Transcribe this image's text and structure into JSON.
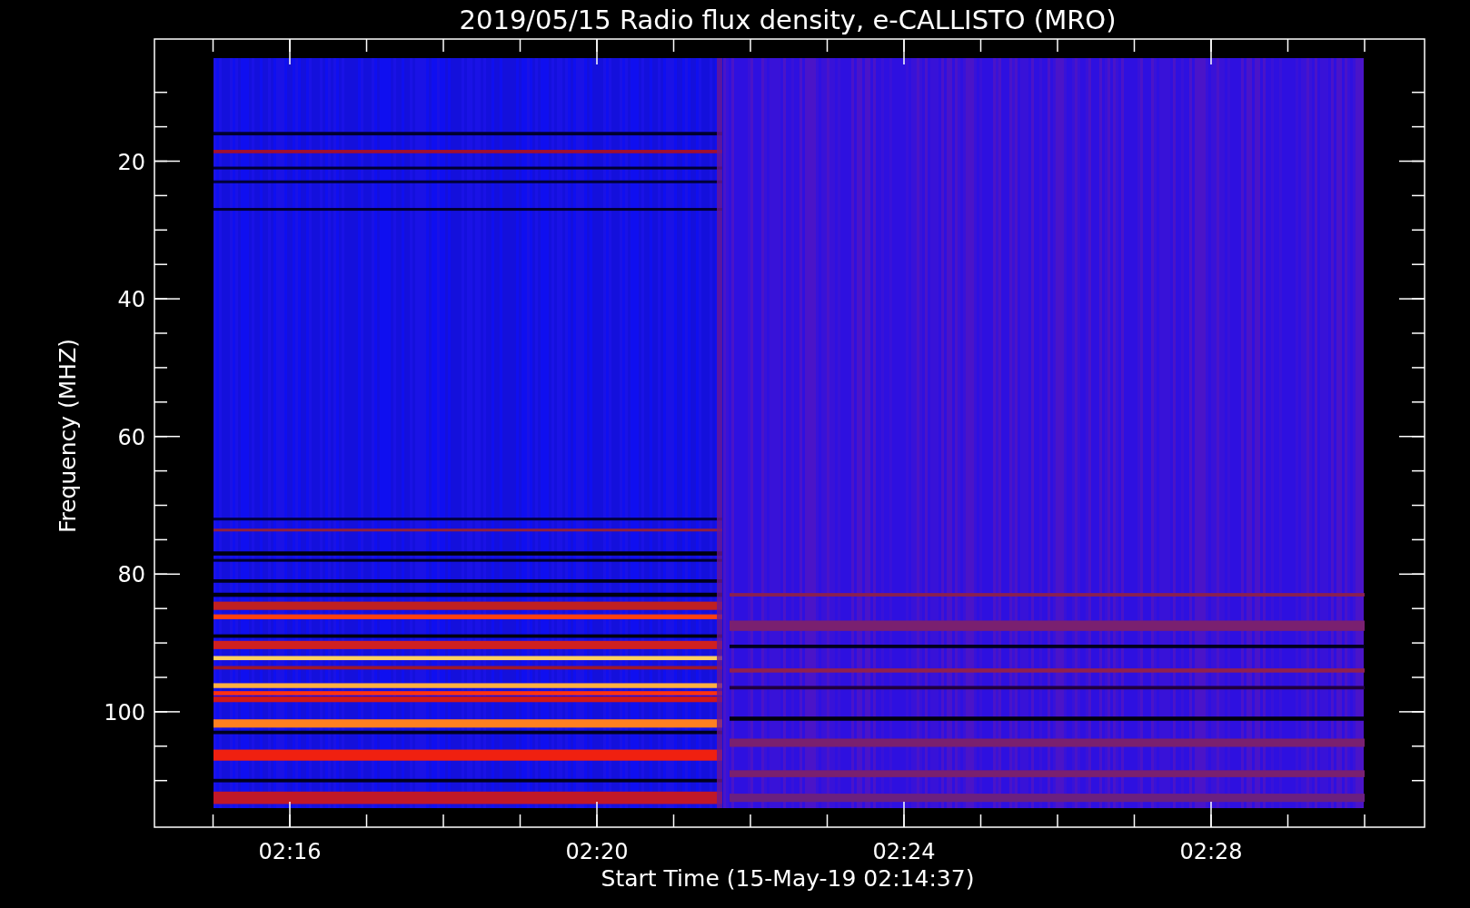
{
  "title": "2019/05/15  Radio flux density, e-CALLISTO (MRO)",
  "y_axis": {
    "label": "Frequency (MHZ)",
    "ticks": [
      "20",
      "40",
      "60",
      "80",
      "100"
    ]
  },
  "x_axis": {
    "label": "Start Time (15-May-19 02:14:37)",
    "ticks": [
      "02:16",
      "02:20",
      "02:24",
      "02:28"
    ]
  }
}
